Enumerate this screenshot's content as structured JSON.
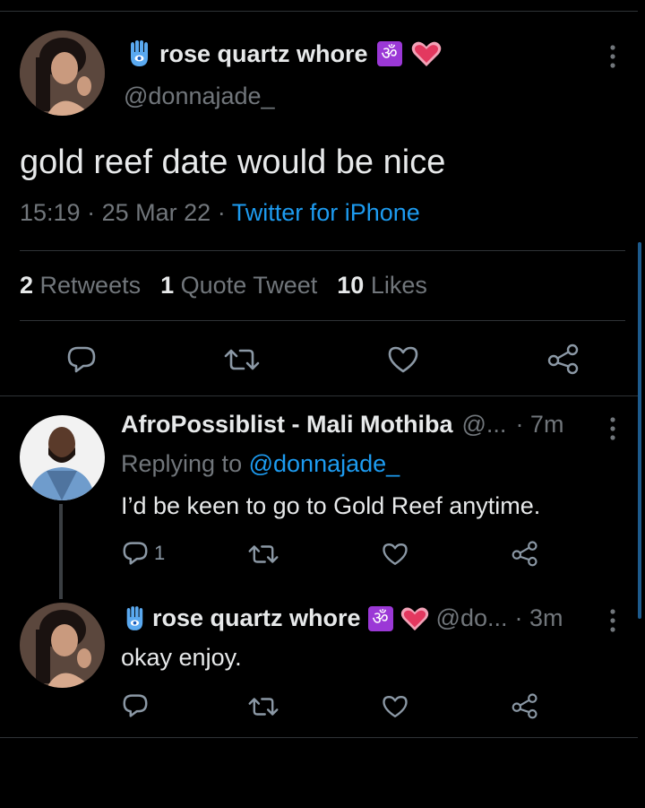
{
  "main_tweet": {
    "display_name": "rose quartz whore",
    "om_glyph": "ॐ",
    "handle": "@donnajade_",
    "text": "gold reef date would be nice",
    "time": "15:19",
    "sep1": "·",
    "date": "25 Mar 22",
    "sep2": "·",
    "client": "Twitter for iPhone",
    "stats": {
      "retweets_count": "2",
      "retweets_label": "Retweets",
      "quotes_count": "1",
      "quotes_label": "Quote Tweet",
      "likes_count": "10",
      "likes_label": "Likes"
    }
  },
  "replies": [
    {
      "display_name": "AfroPossiblist - Mali Mothiba",
      "handle": "@...",
      "time": "· 7m",
      "replying_prefix": "Replying to",
      "replying_to": "@donnajade_",
      "text": "I’d be keen to go to Gold Reef anytime.",
      "reply_count": "1"
    },
    {
      "display_name": "rose quartz whore",
      "om_glyph": "ॐ",
      "handle": "@do...",
      "time": "· 3m",
      "text": "okay enjoy."
    }
  ],
  "colors": {
    "background": "#000000",
    "text": "#e7e9ea",
    "muted": "#71767b",
    "link": "#1d9bf0",
    "divider": "#2f3336"
  },
  "icons": [
    "hamsa-icon",
    "om-icon",
    "heart-emoji-icon",
    "more-icon",
    "reply-icon",
    "retweet-icon",
    "like-icon",
    "share-icon"
  ]
}
